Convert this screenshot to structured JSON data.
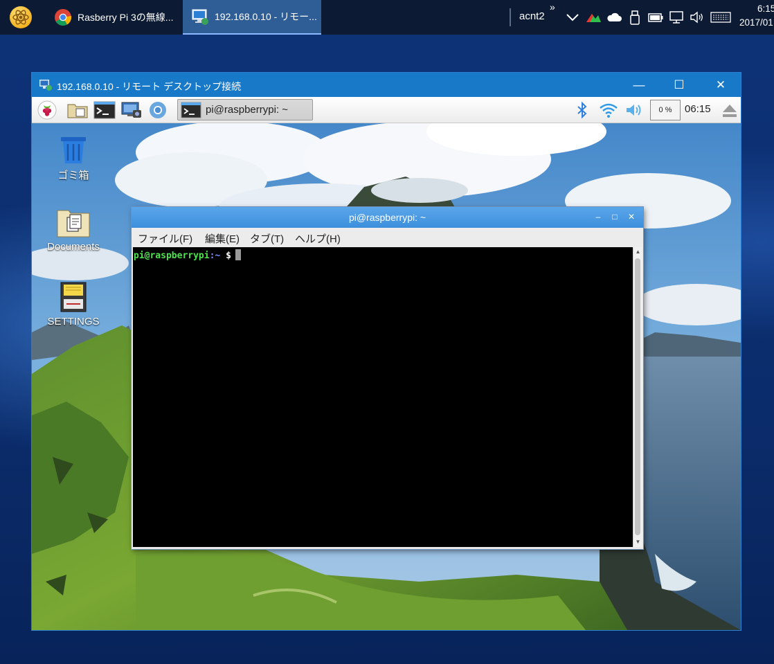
{
  "taskbar": {
    "tasks": [
      {
        "label": "Rasberry Pi 3の無線...",
        "icon": "chrome-icon"
      },
      {
        "label": "192.168.0.10 - リモー...",
        "icon": "remote-desktop-icon"
      }
    ],
    "tray_user": "acnt2",
    "tray_more": "»",
    "clock_time": "6:15",
    "clock_date": "2017/01"
  },
  "rdp_window": {
    "title": "192.168.0.10 - リモート デスクトップ接続",
    "minimize": "—",
    "maximize": "☐",
    "close": "✕"
  },
  "lx_panel": {
    "task_label": "pi@raspberrypi: ~",
    "cpu": "0 %",
    "time": "06:15"
  },
  "desktop_icons": [
    {
      "label": "ゴミ箱",
      "icon": "trash-icon"
    },
    {
      "label": "Documents",
      "icon": "documents-folder-icon"
    },
    {
      "label": "SETTINGS",
      "icon": "sd-card-settings-icon"
    }
  ],
  "terminal": {
    "title": "pi@raspberrypi: ~",
    "menu": [
      "ファイル(F)",
      "編集(E)",
      "タブ(T)",
      "ヘルプ(H)"
    ],
    "prompt_user": "pi@raspberrypi",
    "prompt_path": ":~",
    "prompt_symbol": "$"
  },
  "colors": {
    "taskbar": "#0c1a33",
    "rdp_title": "#1979c9",
    "terminal_title": "#3d8fdc",
    "prompt_user": "#4de34d",
    "prompt_path": "#7a8dff"
  }
}
